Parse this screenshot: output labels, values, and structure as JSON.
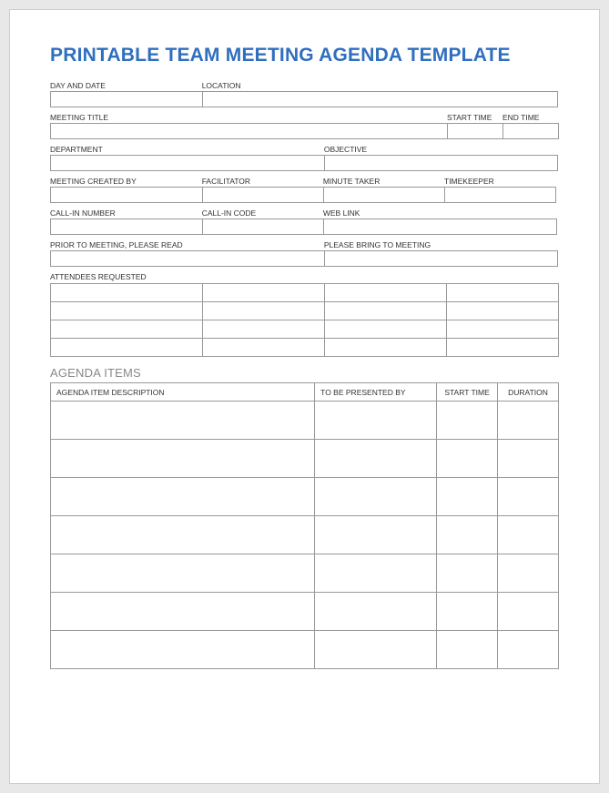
{
  "title": "PRINTABLE TEAM MEETING AGENDA TEMPLATE",
  "labels": {
    "day_date": "DAY AND DATE",
    "location": "LOCATION",
    "meeting_title": "MEETING TITLE",
    "start_time": "START TIME",
    "end_time": "END TIME",
    "department": "DEPARTMENT",
    "objective": "OBJECTIVE",
    "created_by": "MEETING CREATED BY",
    "facilitator": "FACILITATOR",
    "minute_taker": "MINUTE TAKER",
    "timekeeper": "TIMEKEEPER",
    "callin_number": "CALL-IN NUMBER",
    "callin_code": "CALL-IN CODE",
    "web_link": "WEB LINK",
    "prior_read": "PRIOR TO MEETING, PLEASE READ",
    "please_bring": "PLEASE BRING TO MEETING",
    "attendees": "ATTENDEES REQUESTED"
  },
  "section": {
    "agenda_items": "AGENDA ITEMS"
  },
  "agenda_headers": {
    "description": "AGENDA ITEM DESCRIPTION",
    "presented_by": "TO BE PRESENTED BY",
    "start_time": "START TIME",
    "duration": "DURATION"
  },
  "attendees_rows": 4,
  "attendees_cols": 4,
  "agenda_rows": 7
}
